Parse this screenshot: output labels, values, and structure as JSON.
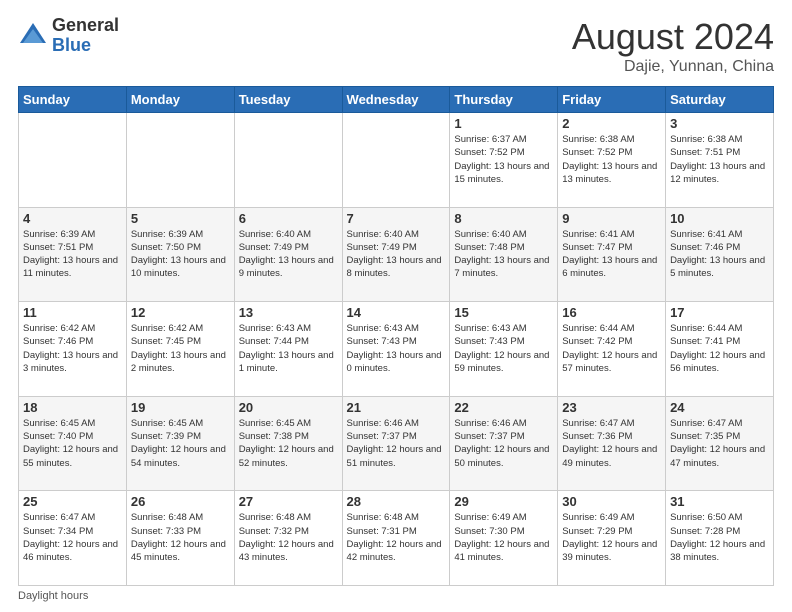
{
  "logo": {
    "general": "General",
    "blue": "Blue"
  },
  "title": {
    "month_year": "August 2024",
    "location": "Dajie, Yunnan, China"
  },
  "days_of_week": [
    "Sunday",
    "Monday",
    "Tuesday",
    "Wednesday",
    "Thursday",
    "Friday",
    "Saturday"
  ],
  "weeks": [
    [
      {
        "day": "",
        "info": ""
      },
      {
        "day": "",
        "info": ""
      },
      {
        "day": "",
        "info": ""
      },
      {
        "day": "",
        "info": ""
      },
      {
        "day": "1",
        "info": "Sunrise: 6:37 AM\nSunset: 7:52 PM\nDaylight: 13 hours and 15 minutes."
      },
      {
        "day": "2",
        "info": "Sunrise: 6:38 AM\nSunset: 7:52 PM\nDaylight: 13 hours and 13 minutes."
      },
      {
        "day": "3",
        "info": "Sunrise: 6:38 AM\nSunset: 7:51 PM\nDaylight: 13 hours and 12 minutes."
      }
    ],
    [
      {
        "day": "4",
        "info": "Sunrise: 6:39 AM\nSunset: 7:51 PM\nDaylight: 13 hours and 11 minutes."
      },
      {
        "day": "5",
        "info": "Sunrise: 6:39 AM\nSunset: 7:50 PM\nDaylight: 13 hours and 10 minutes."
      },
      {
        "day": "6",
        "info": "Sunrise: 6:40 AM\nSunset: 7:49 PM\nDaylight: 13 hours and 9 minutes."
      },
      {
        "day": "7",
        "info": "Sunrise: 6:40 AM\nSunset: 7:49 PM\nDaylight: 13 hours and 8 minutes."
      },
      {
        "day": "8",
        "info": "Sunrise: 6:40 AM\nSunset: 7:48 PM\nDaylight: 13 hours and 7 minutes."
      },
      {
        "day": "9",
        "info": "Sunrise: 6:41 AM\nSunset: 7:47 PM\nDaylight: 13 hours and 6 minutes."
      },
      {
        "day": "10",
        "info": "Sunrise: 6:41 AM\nSunset: 7:46 PM\nDaylight: 13 hours and 5 minutes."
      }
    ],
    [
      {
        "day": "11",
        "info": "Sunrise: 6:42 AM\nSunset: 7:46 PM\nDaylight: 13 hours and 3 minutes."
      },
      {
        "day": "12",
        "info": "Sunrise: 6:42 AM\nSunset: 7:45 PM\nDaylight: 13 hours and 2 minutes."
      },
      {
        "day": "13",
        "info": "Sunrise: 6:43 AM\nSunset: 7:44 PM\nDaylight: 13 hours and 1 minute."
      },
      {
        "day": "14",
        "info": "Sunrise: 6:43 AM\nSunset: 7:43 PM\nDaylight: 13 hours and 0 minutes."
      },
      {
        "day": "15",
        "info": "Sunrise: 6:43 AM\nSunset: 7:43 PM\nDaylight: 12 hours and 59 minutes."
      },
      {
        "day": "16",
        "info": "Sunrise: 6:44 AM\nSunset: 7:42 PM\nDaylight: 12 hours and 57 minutes."
      },
      {
        "day": "17",
        "info": "Sunrise: 6:44 AM\nSunset: 7:41 PM\nDaylight: 12 hours and 56 minutes."
      }
    ],
    [
      {
        "day": "18",
        "info": "Sunrise: 6:45 AM\nSunset: 7:40 PM\nDaylight: 12 hours and 55 minutes."
      },
      {
        "day": "19",
        "info": "Sunrise: 6:45 AM\nSunset: 7:39 PM\nDaylight: 12 hours and 54 minutes."
      },
      {
        "day": "20",
        "info": "Sunrise: 6:45 AM\nSunset: 7:38 PM\nDaylight: 12 hours and 52 minutes."
      },
      {
        "day": "21",
        "info": "Sunrise: 6:46 AM\nSunset: 7:37 PM\nDaylight: 12 hours and 51 minutes."
      },
      {
        "day": "22",
        "info": "Sunrise: 6:46 AM\nSunset: 7:37 PM\nDaylight: 12 hours and 50 minutes."
      },
      {
        "day": "23",
        "info": "Sunrise: 6:47 AM\nSunset: 7:36 PM\nDaylight: 12 hours and 49 minutes."
      },
      {
        "day": "24",
        "info": "Sunrise: 6:47 AM\nSunset: 7:35 PM\nDaylight: 12 hours and 47 minutes."
      }
    ],
    [
      {
        "day": "25",
        "info": "Sunrise: 6:47 AM\nSunset: 7:34 PM\nDaylight: 12 hours and 46 minutes."
      },
      {
        "day": "26",
        "info": "Sunrise: 6:48 AM\nSunset: 7:33 PM\nDaylight: 12 hours and 45 minutes."
      },
      {
        "day": "27",
        "info": "Sunrise: 6:48 AM\nSunset: 7:32 PM\nDaylight: 12 hours and 43 minutes."
      },
      {
        "day": "28",
        "info": "Sunrise: 6:48 AM\nSunset: 7:31 PM\nDaylight: 12 hours and 42 minutes."
      },
      {
        "day": "29",
        "info": "Sunrise: 6:49 AM\nSunset: 7:30 PM\nDaylight: 12 hours and 41 minutes."
      },
      {
        "day": "30",
        "info": "Sunrise: 6:49 AM\nSunset: 7:29 PM\nDaylight: 12 hours and 39 minutes."
      },
      {
        "day": "31",
        "info": "Sunrise: 6:50 AM\nSunset: 7:28 PM\nDaylight: 12 hours and 38 minutes."
      }
    ]
  ],
  "footer": {
    "note": "Daylight hours"
  }
}
